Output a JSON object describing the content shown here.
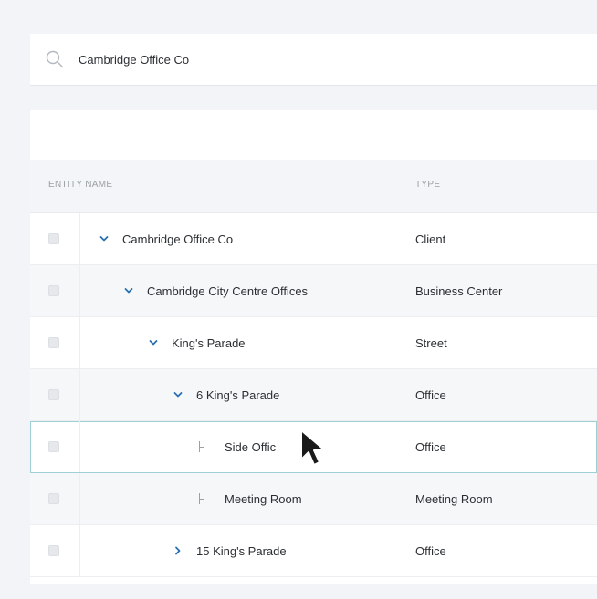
{
  "search": {
    "value": "Cambridge Office Co",
    "icon": "search-icon"
  },
  "table": {
    "columns": {
      "name": "ENTITY NAME",
      "type": "TYPE"
    },
    "rows": [
      {
        "name": "Cambridge Office Co",
        "type": "Client",
        "level": 0,
        "toggle": "expanded"
      },
      {
        "name": "Cambridge City Centre Offices",
        "type": "Business Center",
        "level": 1,
        "toggle": "expanded"
      },
      {
        "name": "King's Parade",
        "type": "Street",
        "level": 2,
        "toggle": "expanded"
      },
      {
        "name": "6 King's Parade",
        "type": "Office",
        "level": 3,
        "toggle": "expanded"
      },
      {
        "name": "Side Offic",
        "type": "Office",
        "level": 4,
        "toggle": "leaf",
        "selected": true
      },
      {
        "name": "Meeting Room",
        "type": "Meeting Room",
        "level": 4,
        "toggle": "leaf"
      },
      {
        "name": "15 King's Parade",
        "type": "Office",
        "level": 3,
        "toggle": "collapsed"
      }
    ]
  },
  "colors": {
    "accent": "#2b6fb3",
    "selected_outline": "#9fd0d6",
    "background": "#f3f4f7"
  }
}
